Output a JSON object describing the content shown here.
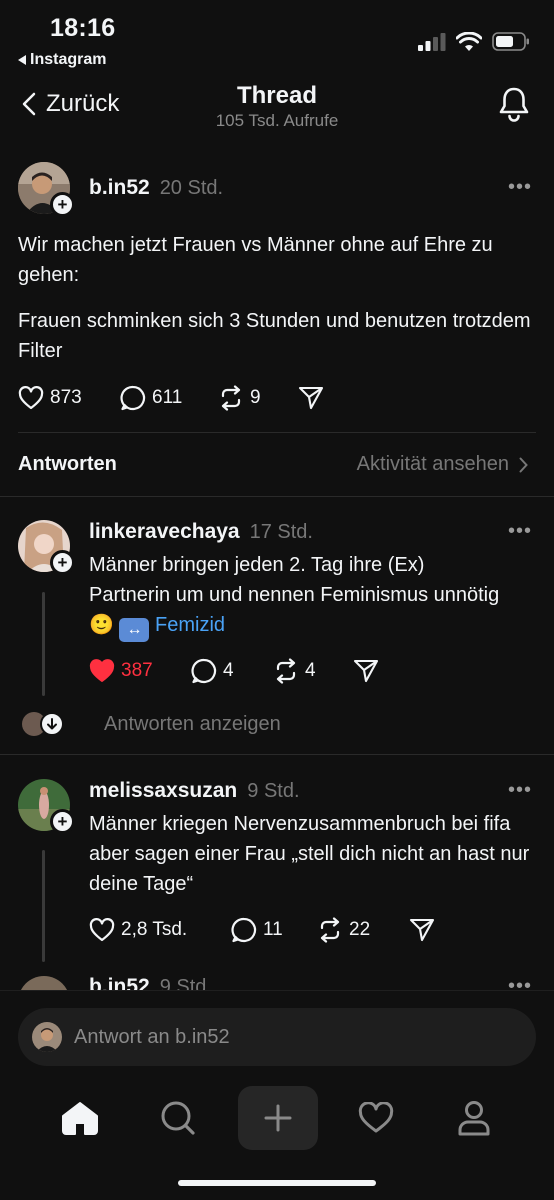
{
  "status_bar": {
    "time": "18:16",
    "back_app": "Instagram"
  },
  "nav": {
    "back_label": "Zurück",
    "title": "Thread",
    "subtitle": "105 Tsd. Aufrufe"
  },
  "main_post": {
    "username": "b.in52",
    "time": "20 Std.",
    "paragraphs": [
      "Wir machen jetzt Frauen vs Männer ohne auf Ehre zu gehen:",
      "Frauen schminken sich 3 Stunden und benutzen trotzdem Filter"
    ],
    "likes": "873",
    "comments": "611",
    "reposts": "9"
  },
  "replies_header": {
    "label": "Antworten",
    "activity_link": "Aktivität ansehen"
  },
  "replies": [
    {
      "username": "linkeravechaya",
      "time": "17 Std.",
      "text": "Männer bringen jeden 2. Tag ihre (Ex) Partnerin um und nennen Feminismus unnötig",
      "emoji": "🙂",
      "arrow_emoji": "↔",
      "hashtag": "Femizid",
      "likes": "387",
      "liked": true,
      "comments": "4",
      "reposts": "4",
      "show_replies": "Antworten anzeigen"
    },
    {
      "username": "melissaxsuzan",
      "time": "9 Std.",
      "text": "Männer kriegen Nervenzusammenbruch bei fifa aber sagen einer Frau „stell dich nicht an hast nur deine Tage“",
      "likes": "2,8 Tsd.",
      "comments": "11",
      "reposts": "22"
    },
    {
      "username": "b.in52",
      "time": "9 Std."
    }
  ],
  "reply_input": {
    "placeholder": "Antwort an b.in52"
  },
  "colors": {
    "background": "#101010",
    "like_red": "#ff3040",
    "hashtag_blue": "#4aa2f5"
  },
  "tabs": [
    "home-icon",
    "search-icon",
    "compose-icon",
    "heart-icon",
    "profile-icon"
  ]
}
